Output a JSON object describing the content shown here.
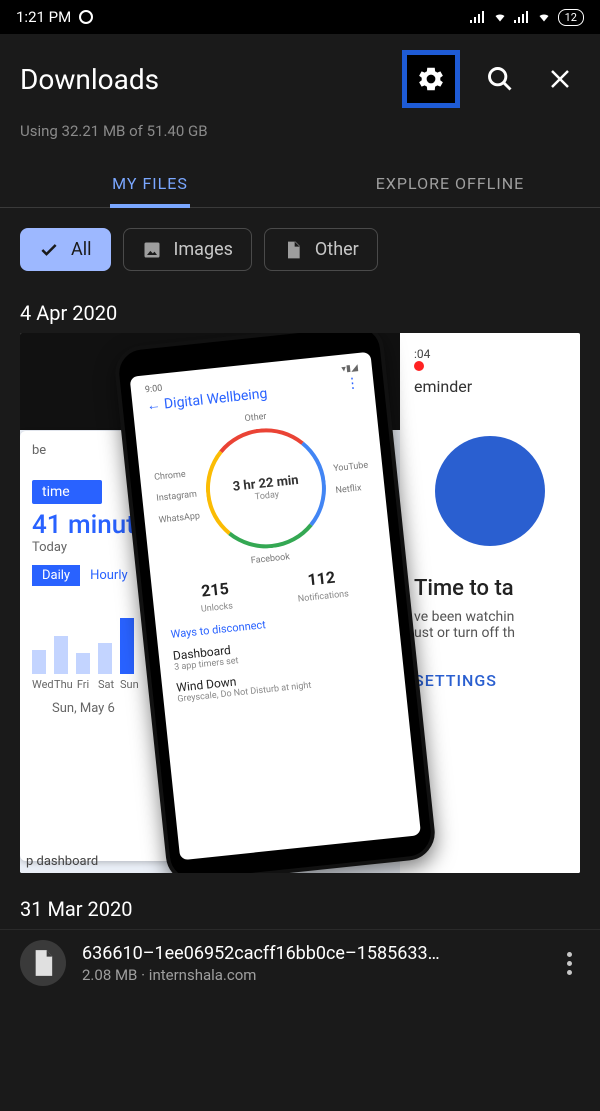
{
  "status": {
    "time": "1:21 PM",
    "battery": "12"
  },
  "header": {
    "title": "Downloads"
  },
  "storage": {
    "line": "Using 32.21 MB of 51.40 GB"
  },
  "tabs": {
    "myfiles": "MY FILES",
    "explore": "EXPLORE OFFLINE"
  },
  "chips": {
    "all": "All",
    "images": "Images",
    "other": "Other"
  },
  "groups": [
    {
      "date": "4 Apr 2020"
    },
    {
      "date": "31 Mar 2020"
    }
  ],
  "thumb": {
    "left": {
      "be": "be",
      "time": "time",
      "minutes": "41 minutes",
      "today": "Today",
      "daily": "Daily",
      "hourly": "Hourly",
      "days": [
        "Wed",
        "Thu",
        "Fri",
        "Sat",
        "Sun"
      ],
      "date": "Sun, May 6",
      "foot": "p dashboard"
    },
    "center": {
      "clock": "9:00",
      "title": "Digital Wellbeing",
      "ring_main": "3 hr 22 min",
      "ring_sub": "Today",
      "apps": [
        "Other",
        "YouTube",
        "Chrome",
        "Netflix",
        "Instagram",
        "WhatsApp",
        "Facebook"
      ],
      "unlocks_n": "215",
      "unlocks_l": "Unlocks",
      "notif_n": "112",
      "notif_l": "Notifications",
      "ways": "Ways to disconnect",
      "dash": "Dashboard",
      "dash_sub": "3 app timers set",
      "wind": "Wind Down",
      "wind_sub": "Greyscale, Do Not Disturb at night"
    },
    "right": {
      "tstamp": ":04",
      "eminder": "eminder",
      "title": "Time to ta",
      "line1": "ve been watchin",
      "line2": "ust or turn off th",
      "settings": "SETTINGS"
    }
  },
  "file": {
    "name": "636610–1ee06952cacff16bb0ce–1585633…",
    "size": "2.08 MB",
    "sep": " · ",
    "source": "internshala.com"
  }
}
